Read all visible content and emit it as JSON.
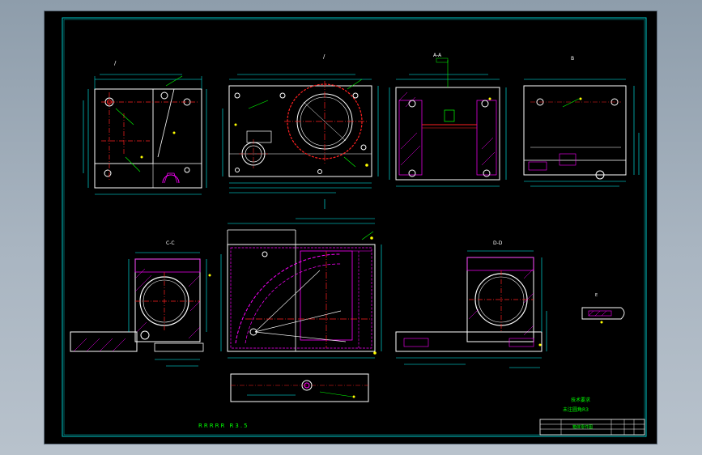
{
  "sheet": {
    "background": "#000000",
    "viewport_background": "#9aa8b6"
  },
  "palette": {
    "border": "#00c8c8",
    "outline": "#ffffff",
    "dimension": "#00ffff",
    "centerline": "#ff2020",
    "hatch": "#ff00ff",
    "leader": "#00ff00",
    "note": "#ffff00",
    "hidden": "#8080ff"
  },
  "views": {
    "top_left_label": "/",
    "top_mid_label": "/",
    "top_right_label": "A-A",
    "far_right_label": "B",
    "section_c_label": "C-C",
    "section_d_label": "D-D",
    "detail_label": "E"
  },
  "notes": {
    "bottom_note": "RRRRR R3.5",
    "title_line_1": "技术要求",
    "title_line_2": "未注圆角R3"
  },
  "title_block": {
    "row1": "箱体零件图"
  }
}
